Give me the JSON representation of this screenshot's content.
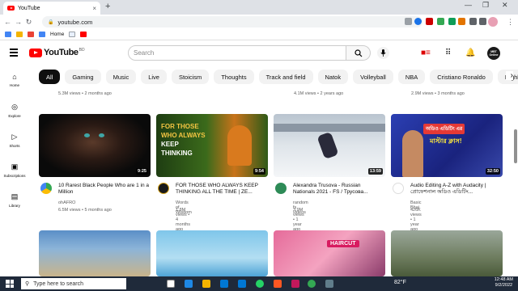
{
  "browser": {
    "tab_title": "YouTube",
    "tab_close": "×",
    "new_tab": "+",
    "url": "youtube.com",
    "bookmarks": [
      {
        "label": "Home"
      }
    ]
  },
  "header": {
    "logo_text": "YouTube",
    "country_code": "BD",
    "search_placeholder": "Search",
    "avatar_text": "MBT Online"
  },
  "chips": [
    "All",
    "Gaming",
    "Music",
    "Live",
    "Stoicism",
    "Thoughts",
    "Track and field",
    "Natok",
    "Volleyball",
    "NBA",
    "Cristiano Ronaldo",
    "Highlight film"
  ],
  "rail": [
    {
      "label": "Home",
      "icon": "home-icon"
    },
    {
      "label": "Explore",
      "icon": "compass-icon"
    },
    {
      "label": "Shorts",
      "icon": "shorts-icon"
    },
    {
      "label": "Subscriptions",
      "icon": "subscriptions-icon"
    },
    {
      "label": "Library",
      "icon": "library-icon"
    }
  ],
  "top_partial_row": [
    {
      "meta": "5.3M views • 2 months ago"
    },
    {
      "meta": "",
      "channel": ""
    },
    {
      "meta": "4.1M views • 2 years ago"
    },
    {
      "meta": "2.9M views • 3 months ago"
    }
  ],
  "videos": [
    {
      "title": "10 Rarest Black People Who are 1 in a Million",
      "channel": "ohAFRO",
      "meta": "6.5M views • 5 months ago",
      "duration": "9:25"
    },
    {
      "title": "FOR THOSE WHO ALWAYS KEEP THINKING ALL THE TIME | ZE...",
      "channel": "Words of Wisdom",
      "meta": "1.8M views • 4 months ago",
      "duration": "9:54",
      "thumb_text": [
        "FOR THOSE",
        "WHO ALWAYS",
        "KEEP",
        "THINKING"
      ]
    },
    {
      "title": "Alexandra Trusova - Russian Nationals 2021 - FS / Трусова...",
      "channel": "random fs videos",
      "meta": "3.9M views • 1 year ago",
      "duration": "13:59"
    },
    {
      "title": "Audio Editing A-Z with Audacity | প্রোফেশনাল অডিও এডিটিং...",
      "channel": "Basic Bhai",
      "meta": "426K views • 1 year ago",
      "duration": "32:50",
      "thumb_text": [
        "অডিও এডিটিং এর",
        "মাস্টার ক্লাস!"
      ]
    }
  ],
  "bottom_row_thumb_text": "HAIRCUT",
  "taskbar": {
    "search_placeholder": "Type here to search",
    "weather": "82°F",
    "time": "12:48 AM",
    "date": "9/2/2022"
  },
  "colors": {
    "brand_red": "#ff0000",
    "chip_active": "#0f0f0f",
    "chip_bg": "#f2f2f2"
  }
}
